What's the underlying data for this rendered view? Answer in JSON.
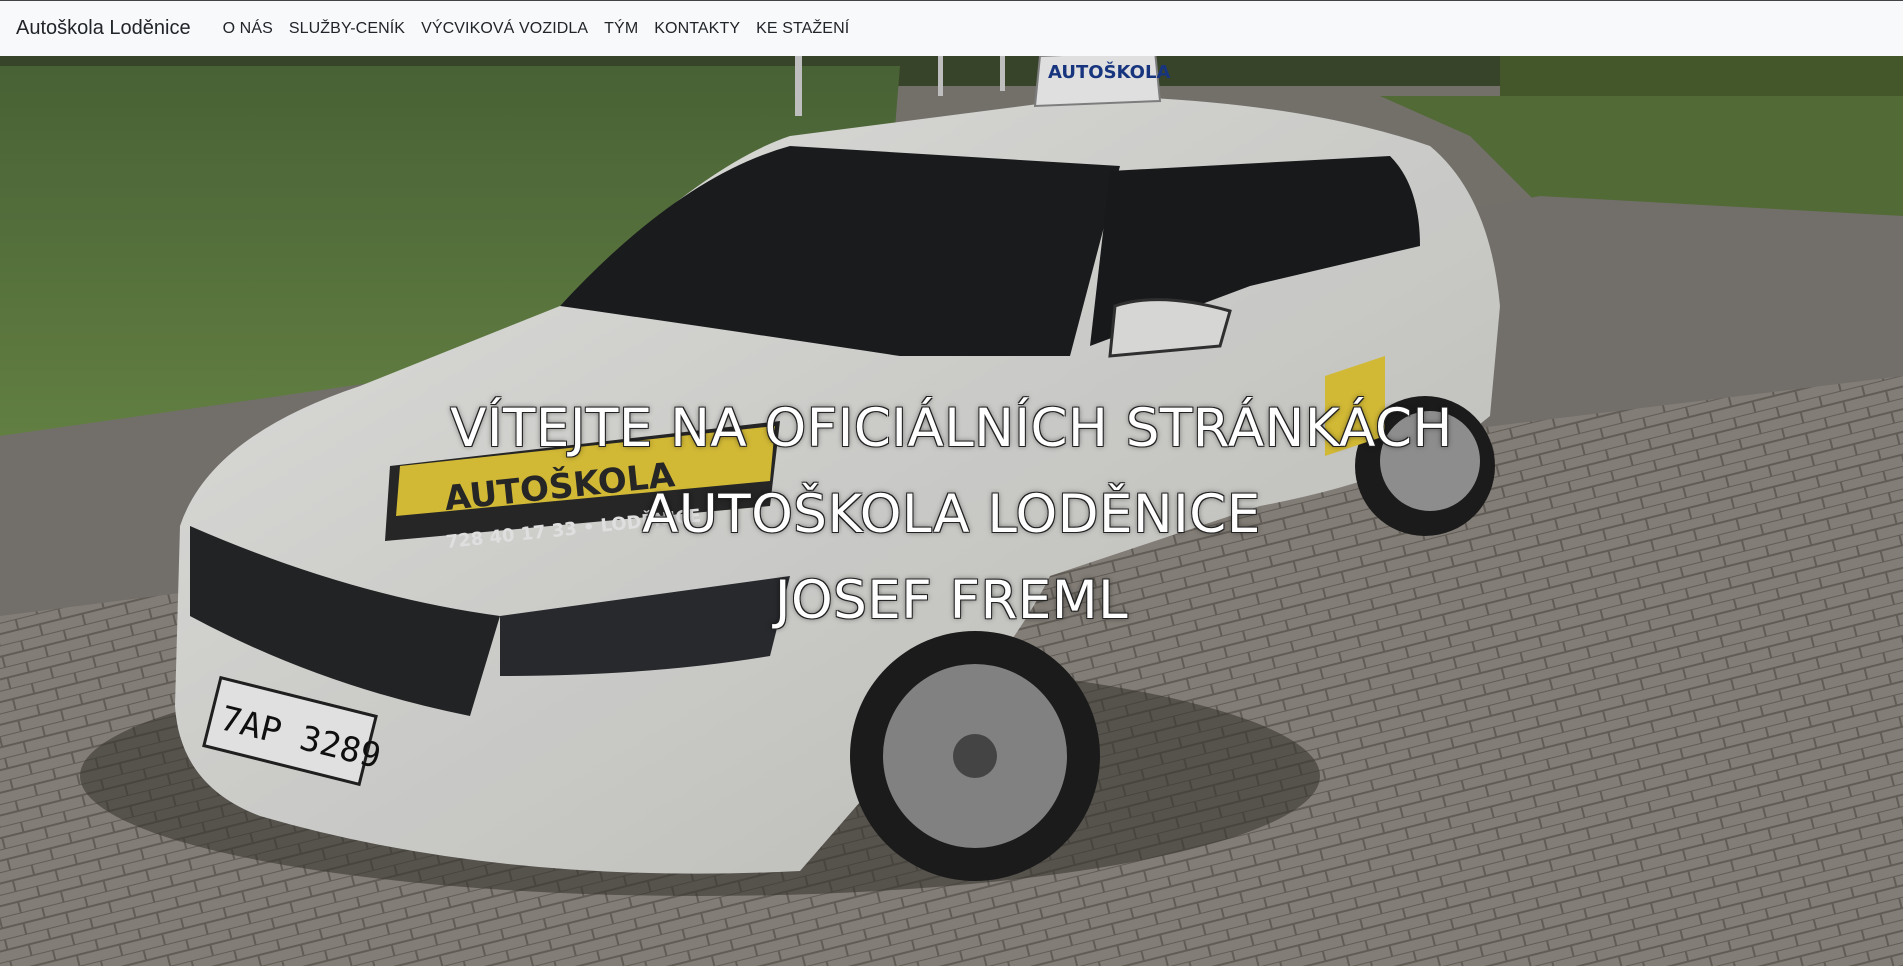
{
  "navbar": {
    "brand": "Autoškola Loděnice",
    "links": [
      "O NÁS",
      "SLUŽBY-CENÍK",
      "VÝCVIKOVÁ VOZIDLA",
      "TÝM",
      "KONTAKTY",
      "KE STAŽENÍ"
    ],
    "background": "#f8f9fa"
  },
  "hero": {
    "lines": [
      "VÍTEJTE NA OFICIÁLNÍCH STRÁNKÁCH",
      "AUTOŠKOLA LODĚNICE",
      "JOSEF FREML"
    ],
    "image": {
      "sign_text": "AUTOŠKOLA",
      "hood_text": "AUTOŠKOLA",
      "phone_text": "728 40 17 33 • LODĚNICE",
      "plate_text": "7AP 3289"
    }
  }
}
